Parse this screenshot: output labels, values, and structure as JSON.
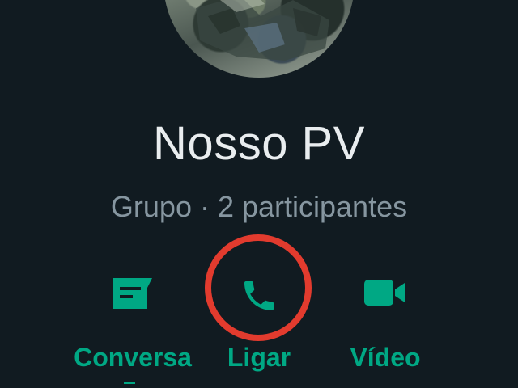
{
  "profile": {
    "name": "Nosso PV",
    "subtitle": "Grupo · 2 participantes",
    "avatar_icon": "group-photo"
  },
  "actions": [
    {
      "label": "Conversa",
      "icon": "message-icon"
    },
    {
      "label": "Ligar",
      "icon": "phone-icon"
    },
    {
      "label": "Vídeo",
      "icon": "video-camera-icon"
    }
  ],
  "colors": {
    "background": "#111b21",
    "primary_text": "#e9edef",
    "secondary_text": "#8696a0",
    "accent": "#00a884",
    "highlight_circle": "#e23b2e"
  }
}
